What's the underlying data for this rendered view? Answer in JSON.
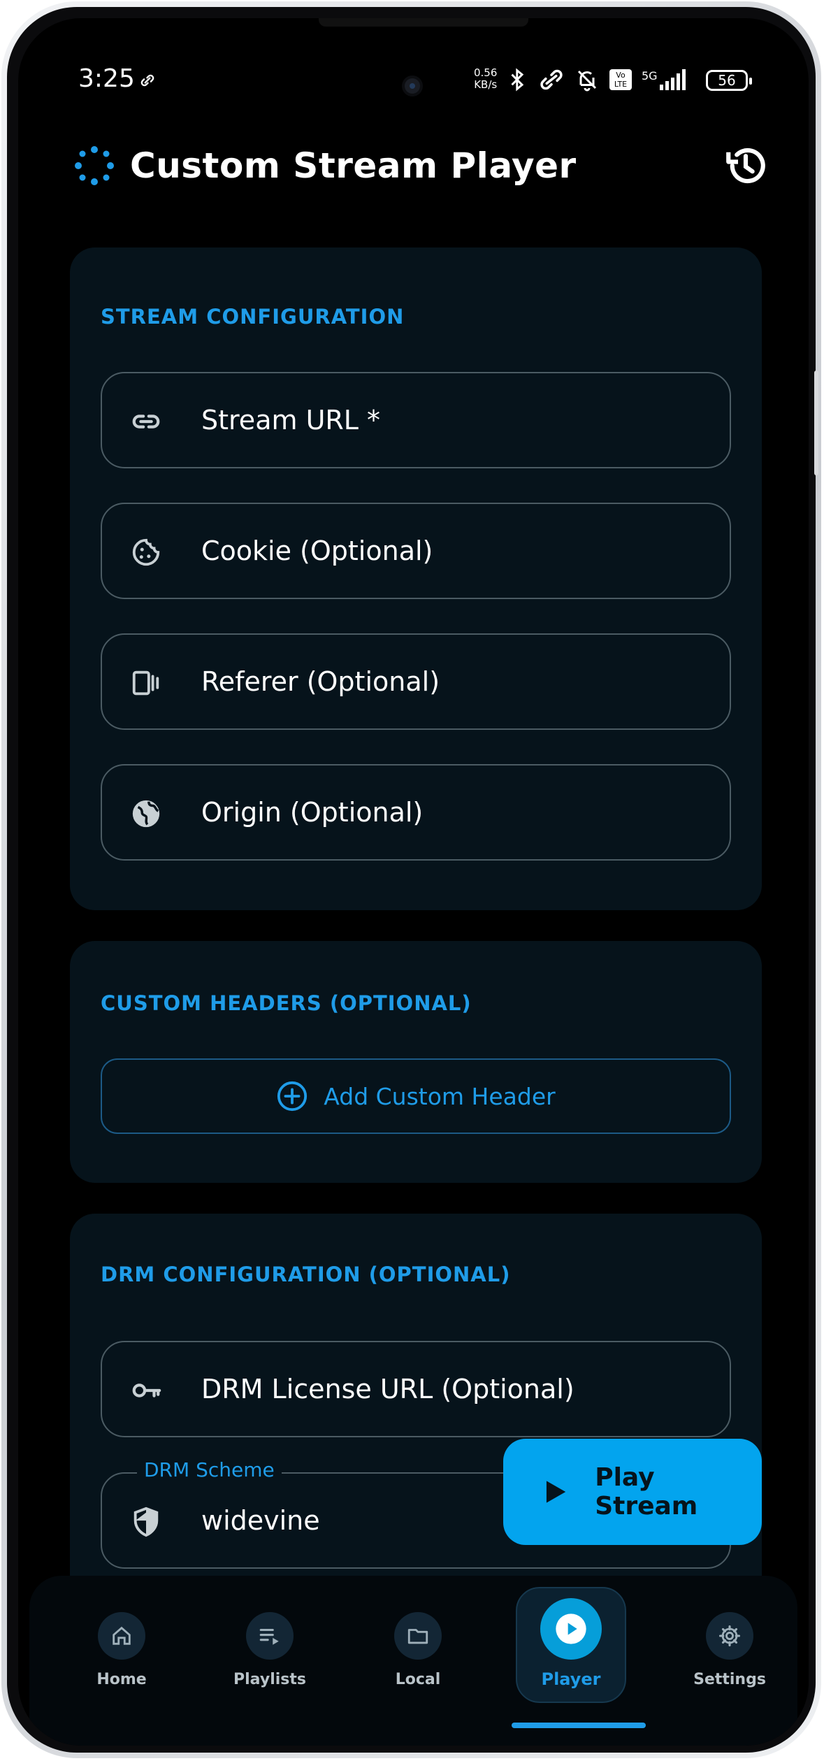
{
  "status_bar": {
    "time": "3:25",
    "speed_value": "0.56",
    "speed_unit": "KB/s",
    "volte": "Vo LTE",
    "network": "5G",
    "battery": "56"
  },
  "header": {
    "title": "Custom Stream Player",
    "history_icon": "history-icon"
  },
  "stream_config": {
    "title": "STREAM CONFIGURATION",
    "fields": [
      {
        "label": "Stream URL *",
        "icon": "link-icon"
      },
      {
        "label": "Cookie (Optional)",
        "icon": "cookie-icon"
      },
      {
        "label": "Referer (Optional)",
        "icon": "referer-icon"
      },
      {
        "label": "Origin (Optional)",
        "icon": "globe-icon"
      }
    ]
  },
  "custom_headers": {
    "title": "CUSTOM HEADERS (OPTIONAL)",
    "add_button": "Add Custom Header"
  },
  "drm_config": {
    "title": "DRM CONFIGURATION (OPTIONAL)",
    "license_url": "DRM License URL (Optional)",
    "scheme_label": "DRM Scheme",
    "scheme_value": "widevine"
  },
  "fab": {
    "label": "Play Stream"
  },
  "nav": {
    "items": [
      {
        "label": "Home",
        "icon": "home-icon"
      },
      {
        "label": "Playlists",
        "icon": "playlist-icon"
      },
      {
        "label": "Local",
        "icon": "folder-icon"
      },
      {
        "label": "Player",
        "icon": "play-circle-icon",
        "active": true
      },
      {
        "label": "Settings",
        "icon": "gear-icon"
      }
    ]
  },
  "colors": {
    "accent": "#1f9ce8",
    "fab": "#03a4ee",
    "card": "#06131b",
    "background": "#000000"
  }
}
